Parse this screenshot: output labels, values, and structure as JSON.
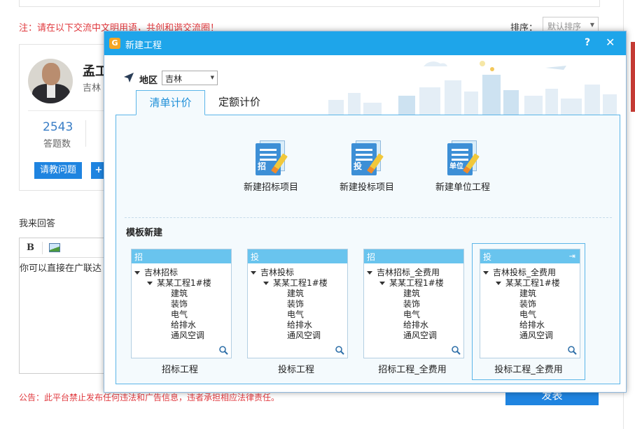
{
  "background": {
    "notice": "注：请在以下交流中文明用语，共创和谐交流圈！",
    "sort_label": "排序：",
    "sort_value": "默认排序",
    "profile": {
      "name": "孟工",
      "location": "吉林",
      "answer_count": "2543",
      "answer_count_label": "答题数",
      "ask_button": "请教问题",
      "plus_button": "+"
    },
    "answer_label": "我来回答",
    "editor_text": "你可以直接在广联达",
    "footer_note": "公告：此平台禁止发布任何违法和广告信息，违者承担相应法律责任。",
    "submit_button": "发表"
  },
  "modal": {
    "title": "新建工程",
    "help": "?",
    "close": "✕",
    "region_label": "地区",
    "region_value": "吉林",
    "tabs": [
      {
        "label": "清单计价",
        "active": true
      },
      {
        "label": "定额计价",
        "active": false
      }
    ],
    "actions": [
      {
        "badge": "招",
        "label": "新建招标项目",
        "icon": "tender-document-icon"
      },
      {
        "badge": "投",
        "label": "新建投标项目",
        "icon": "bid-document-icon"
      },
      {
        "badge": "单位",
        "label": "新建单位工程",
        "icon": "unit-project-document-icon"
      }
    ],
    "template_heading": "模板新建",
    "templates": [
      {
        "tag": "招",
        "root": "吉林招标",
        "project": "某某工程1#楼",
        "items": [
          "建筑",
          "装饰",
          "电气",
          "给排水",
          "通风空调"
        ],
        "name": "招标工程",
        "selected": false
      },
      {
        "tag": "投",
        "root": "吉林投标",
        "project": "某某工程1#楼",
        "items": [
          "建筑",
          "装饰",
          "电气",
          "给排水",
          "通风空调"
        ],
        "name": "投标工程",
        "selected": false
      },
      {
        "tag": "招",
        "root": "吉林招标_全费用",
        "project": "某某工程1#楼",
        "items": [
          "建筑",
          "装饰",
          "电气",
          "给排水",
          "通风空调"
        ],
        "name": "招标工程_全费用",
        "selected": false
      },
      {
        "tag": "投",
        "root": "吉林投标_全费用",
        "project": "某某工程1#楼",
        "items": [
          "建筑",
          "装饰",
          "电气",
          "给排水",
          "通风空调"
        ],
        "name": "投标工程_全费用",
        "selected": true
      }
    ]
  },
  "colors": {
    "titlebar": "#1ea5ea",
    "accent_blue": "#1f84e0",
    "warning_red": "#e0393e",
    "panel_border": "#5bb5e8",
    "template_header": "#69c4ee"
  }
}
